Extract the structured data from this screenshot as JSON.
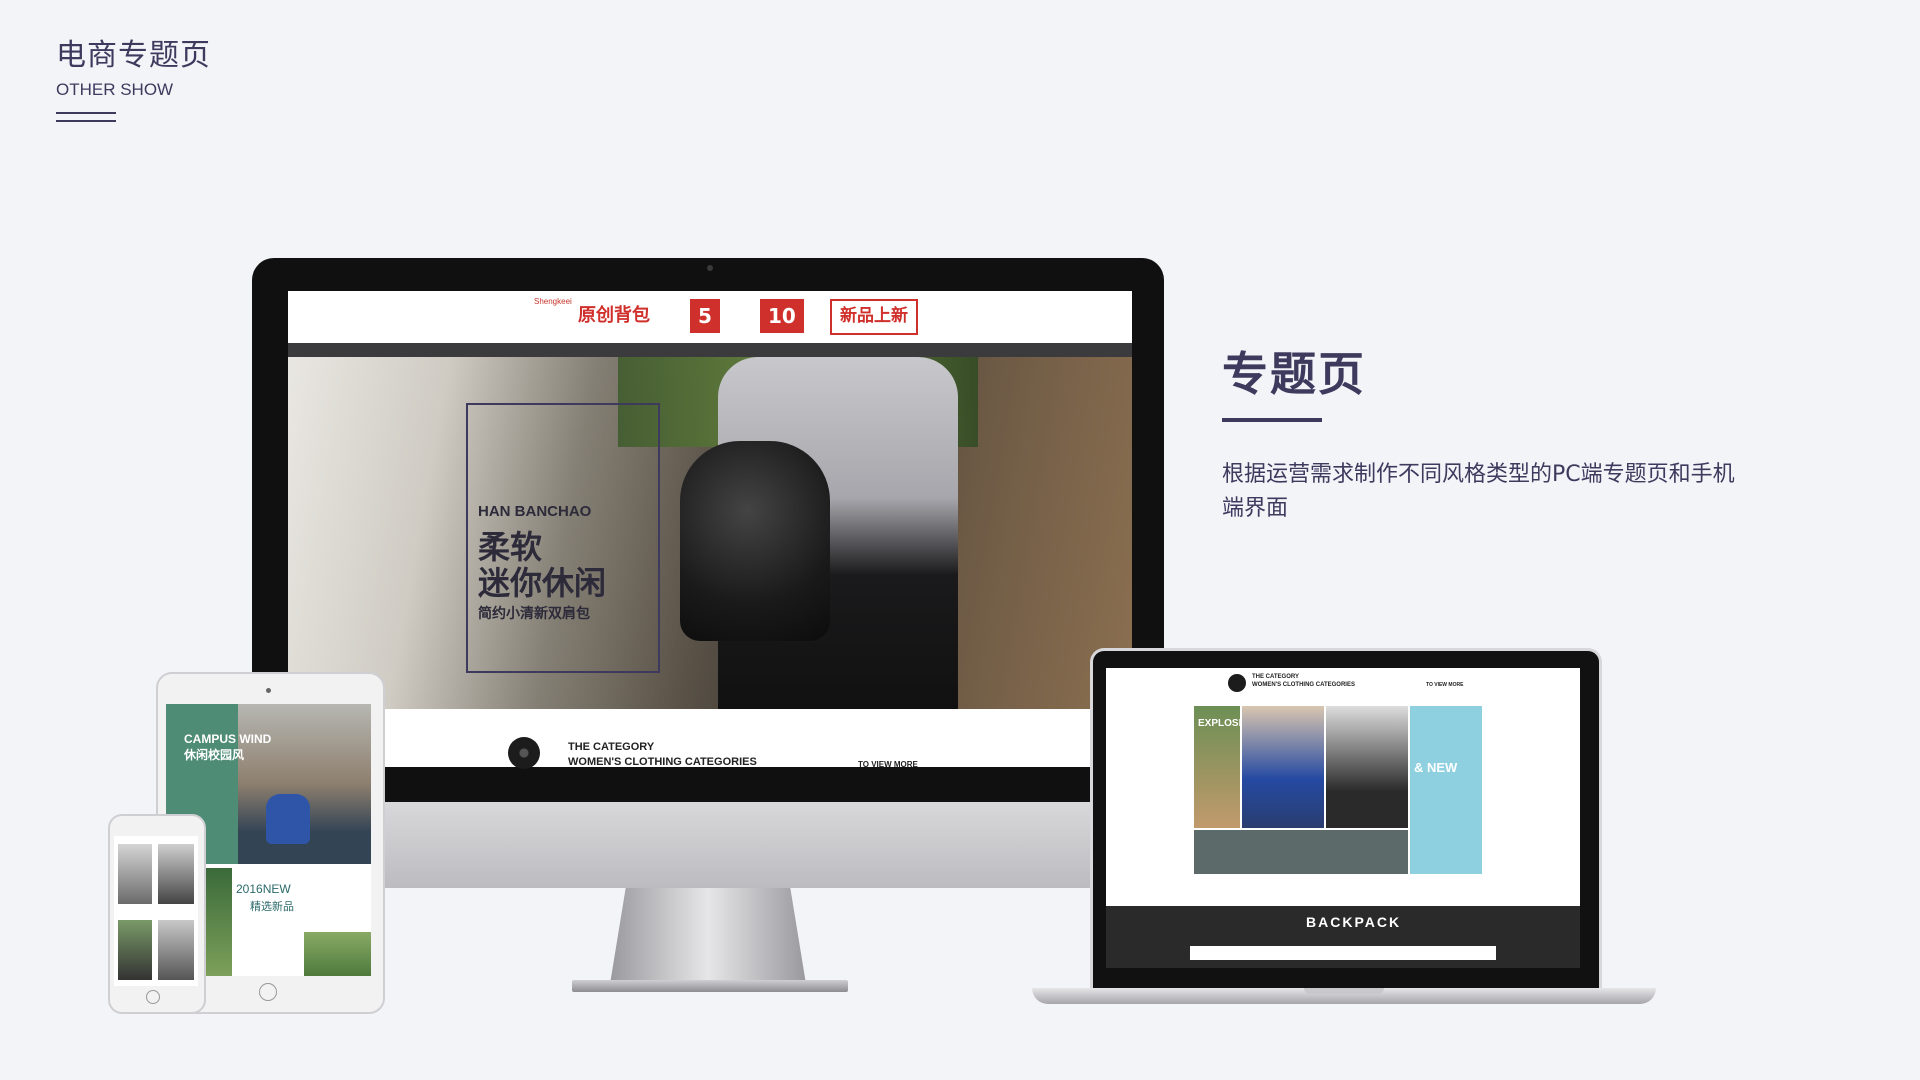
{
  "header": {
    "title": "电商专题页",
    "subtitle": "OTHER SHOW"
  },
  "info": {
    "title": "专题页",
    "description": "根据运营需求制作不同风格类型的PC端专题页和手机端界面"
  },
  "imac_screen": {
    "brand_en": "Shengkeei",
    "brand": "原创背包",
    "coupon1": "5",
    "coupon2": "10",
    "new_badge": "新品上新",
    "hero_en": "HAN BANCHAO",
    "hero_cn_line1": "柔软",
    "hero_cn_line2": "迷你休闲",
    "hero_cn_line3": "简约小清新双肩包",
    "category_title": "THE CATEGORY",
    "category_subtitle": "WOMEN'S CLOTHING CATEGORIES",
    "view_more": "TO VIEW MORE"
  },
  "tablet_screen": {
    "campus_en": "CAMPUS WIND",
    "campus_cn": "休闲校园风",
    "new_label": "2016NEW",
    "new_cn": "精选新品"
  },
  "laptop_screen": {
    "category_title": "THE CATEGORY",
    "category_subtitle": "WOMEN'S CLOTHING CATEGORIES",
    "view_more": "TO VIEW MORE",
    "explosion": "EXPLOSI",
    "new_label": "& NEW",
    "backpack": "BACKPACK"
  },
  "colors": {
    "accent": "#3e3a5e",
    "brand_red": "#d0302c",
    "background": "#f3f4f8"
  }
}
